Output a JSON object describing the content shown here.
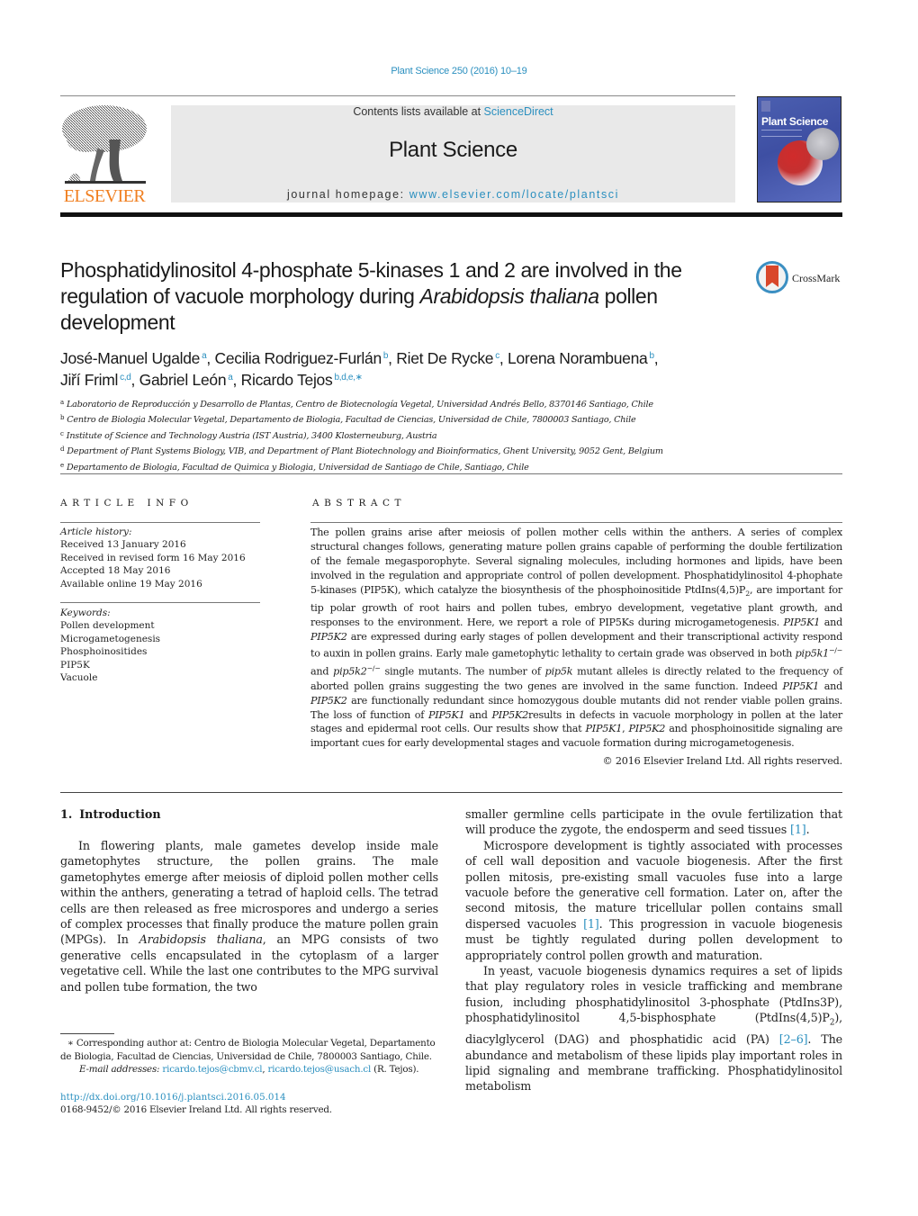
{
  "header": {
    "journal_reference": "Plant Science 250 (2016) 10–19",
    "publisher_logo_text": "ELSEVIER",
    "contents_prefix": "Contents lists available at ",
    "contents_link": "ScienceDirect",
    "journal_title": "Plant Science",
    "homepage_prefix": "journal homepage: ",
    "homepage_link": "www.elsevier.com/locate/plantsci",
    "cover_title": "Plant Science"
  },
  "colors": {
    "link": "#2a8fbf",
    "elsevier_orange": "#f07f20",
    "masthead_gray": "#e9e9e9",
    "cover_blue": "#4b5fb0"
  },
  "article": {
    "title_part1": "Phosphatidylinositol 4-phosphate 5-kinases 1 and 2 are involved in the regulation of vacuole morphology during ",
    "title_italic": "Arabidopsis thaliana",
    "title_part2": " pollen development",
    "crossmark_label": "CrossMark",
    "authors": [
      {
        "name": "José-Manuel Ugalde",
        "affil": "a",
        "sep": ", "
      },
      {
        "name": "Cecilia Rodriguez-Furlán",
        "affil": "b",
        "sep": ", "
      },
      {
        "name": "Riet De Rycke",
        "affil": "c",
        "sep": ", "
      },
      {
        "name": "Lorena Norambuena",
        "affil": "b",
        "sep": ","
      },
      {
        "name": "Jiří Friml",
        "affil": "c,d",
        "sep": ", "
      },
      {
        "name": "Gabriel León",
        "affil": "a",
        "sep": ", "
      },
      {
        "name": "Ricardo Tejos",
        "affil": "b,d,e,∗",
        "sep": ""
      }
    ],
    "affiliations": [
      {
        "key": "a",
        "text": "Laboratorio de Reproducción y Desarrollo de Plantas, Centro de Biotecnología Vegetal, Universidad Andrés Bello, 8370146 Santiago, Chile"
      },
      {
        "key": "b",
        "text": "Centro de Biologia Molecular Vegetal, Departamento de Biologia, Facultad de Ciencias, Universidad de Chile, 7800003 Santiago, Chile"
      },
      {
        "key": "c",
        "text": "Institute of Science and Technology Austria (IST Austria), 3400 Klosterneuburg, Austria"
      },
      {
        "key": "d",
        "text": "Department of Plant Systems Biology, VIB, and Department of Plant Biotechnology and Bioinformatics, Ghent University, 9052 Gent, Belgium"
      },
      {
        "key": "e",
        "text": "Departamento de Biologia, Facultad de Quimica y Biologia, Universidad de Santiago de Chile, Santiago, Chile"
      }
    ]
  },
  "article_info": {
    "heading": "ARTICLE INFO",
    "history_label": "Article history:",
    "history": [
      "Received 13 January 2016",
      "Received in revised form 16 May 2016",
      "Accepted 18 May 2016",
      "Available online 19 May 2016"
    ],
    "keywords_label": "Keywords:",
    "keywords": [
      "Pollen development",
      "Microgametogenesis",
      "Phosphoinositides",
      "PIP5K",
      "Vacuole"
    ]
  },
  "abstract": {
    "heading": "ABSTRACT",
    "segments": [
      {
        "t": "The pollen grains arise after meiosis of pollen mother cells within the anthers. A series of complex structural changes follows, generating mature pollen grains capable of performing the double fertilization of the female megasporophyte. Several signaling molecules, including hormones and lipids, have been involved in the regulation and appropriate control of pollen development. Phosphatidylinositol 4-phophate 5-kinases (PIP5K), which catalyze the biosynthesis of the phosphoinositide PtdIns(4,5)P"
      },
      {
        "t": "2",
        "sub": true
      },
      {
        "t": ", are important for tip polar growth of root hairs and pollen tubes, embryo development, vegetative plant growth, and responses to the environment. Here, we report a role of PIP5Ks during microgametogenesis. "
      },
      {
        "t": "PIP5K1",
        "i": true
      },
      {
        "t": " and "
      },
      {
        "t": "PIP5K2",
        "i": true
      },
      {
        "t": " are expressed during early stages of pollen development and their transcriptional activity respond to auxin in pollen grains. Early male gametophytic lethality to certain grade was observed in both "
      },
      {
        "t": "pip5k1",
        "i": true
      },
      {
        "t": "−/−",
        "sup": true
      },
      {
        "t": " and "
      },
      {
        "t": "pip5k2",
        "i": true
      },
      {
        "t": "−/−",
        "sup": true
      },
      {
        "t": " single mutants. The number of "
      },
      {
        "t": "pip5k",
        "i": true
      },
      {
        "t": " mutant alleles is directly related to the frequency of aborted pollen grains suggesting the two genes are involved in the same function. Indeed "
      },
      {
        "t": "PIP5K1",
        "i": true
      },
      {
        "t": " and "
      },
      {
        "t": "PIP5K2",
        "i": true
      },
      {
        "t": " are functionally redundant since homozygous double mutants did not render viable pollen grains. The loss of function of "
      },
      {
        "t": "PIP5K1",
        "i": true
      },
      {
        "t": " and "
      },
      {
        "t": "PIP5K2",
        "i": true
      },
      {
        "t": "results in defects in vacuole morphology in pollen at the later stages and epidermal root cells. Our results show that "
      },
      {
        "t": "PIP5K1",
        "i": true
      },
      {
        "t": ", "
      },
      {
        "t": "PIP5K2",
        "i": true
      },
      {
        "t": " and phosphoinositide signaling are important cues for early developmental stages and vacuole formation during microgametogenesis."
      }
    ],
    "copyright": "© 2016 Elsevier Ireland Ltd. All rights reserved."
  },
  "body": {
    "section_number": "1.",
    "section_title": "Introduction",
    "left_paragraphs": [
      [
        {
          "t": "In flowering plants, male gametes develop inside male gametophytes structure, the pollen grains. The male gametophytes emerge after meiosis of diploid pollen mother cells within the anthers, generating a tetrad of haploid cells. The tetrad cells are then released as free microspores and undergo a series of complex processes that finally produce the mature pollen grain (MPGs). In "
        },
        {
          "t": "Arabidopsis thaliana",
          "i": true
        },
        {
          "t": ", an MPG consists of two generative cells encapsulated in the cytoplasm of a larger vegetative cell. While the last one contributes to the MPG survival and pollen tube formation, the two"
        }
      ]
    ],
    "right_paragraphs": [
      {
        "noindent": true,
        "segs": [
          {
            "t": "smaller germline cells participate in the ovule fertilization that will produce the zygote, the endosperm and seed tissues "
          },
          {
            "t": "[1]",
            "link": true
          },
          {
            "t": "."
          }
        ]
      },
      {
        "segs": [
          {
            "t": "Microspore development is tightly associated with processes of cell wall deposition and vacuole biogenesis. After the first pollen mitosis, pre-existing small vacuoles fuse into a large vacuole before the generative cell formation. Later on, after the second mitosis, the mature tricellular pollen contains small dispersed vacuoles "
          },
          {
            "t": "[1]",
            "link": true
          },
          {
            "t": ". This progression in vacuole biogenesis must be tightly regulated during pollen development to appropriately control pollen growth and maturation."
          }
        ]
      },
      {
        "segs": [
          {
            "t": "In yeast, vacuole biogenesis dynamics requires a set of lipids that play regulatory roles in vesicle trafficking and membrane fusion, including phosphatidylinositol 3-phosphate (PtdIns3P), phosphatidylinositol 4,5-bisphosphate (PtdIns(4,5)P"
          },
          {
            "t": "2",
            "sub": true
          },
          {
            "t": "), diacylglycerol (DAG) and phosphatidic acid (PA) "
          },
          {
            "t": "[2–6]",
            "link": true
          },
          {
            "t": ". The abundance and metabolism of these lipids play important roles in lipid signaling and membrane trafficking. Phosphatidylinositol metabolism"
          }
        ]
      }
    ]
  },
  "footnotes": {
    "corresponding": "∗ Corresponding author at: Centro de Biologia Molecular Vegetal, Departamento de Biologia, Facultad de Ciencias, Universidad de Chile, 7800003 Santiago, Chile.",
    "email_label": "E-mail addresses:",
    "emails": [
      "ricardo.tejos@cbmv.cl",
      "ricardo.tejos@usach.cl"
    ],
    "email_suffix": " (R. Tejos).",
    "doi": "http://dx.doi.org/10.1016/j.plantsci.2016.05.014",
    "issn": "0168-9452/© 2016 Elsevier Ireland Ltd. All rights reserved."
  }
}
